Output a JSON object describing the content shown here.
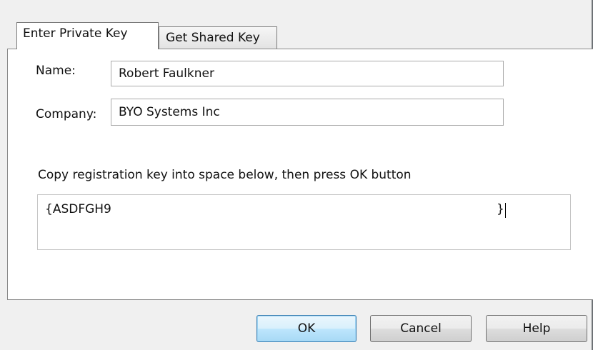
{
  "tabs": [
    {
      "label": "Enter Private Key",
      "active": true
    },
    {
      "label": "Get Shared Key",
      "active": false
    }
  ],
  "form": {
    "name_label": "Name:",
    "name_value": "Robert Faulkner",
    "company_label": "Company:",
    "company_value": "BYO Systems Inc",
    "instructions": "Copy registration key into space below, then press OK button",
    "key_value_start": "{ASDFGH9",
    "key_value_end": "}"
  },
  "buttons": {
    "ok": "OK",
    "cancel": "Cancel",
    "help": "Help"
  },
  "colors": {
    "dialog_background": "#f0f0f0",
    "panel_background": "#ffffff",
    "default_button_accent": "#3c7fb1"
  }
}
